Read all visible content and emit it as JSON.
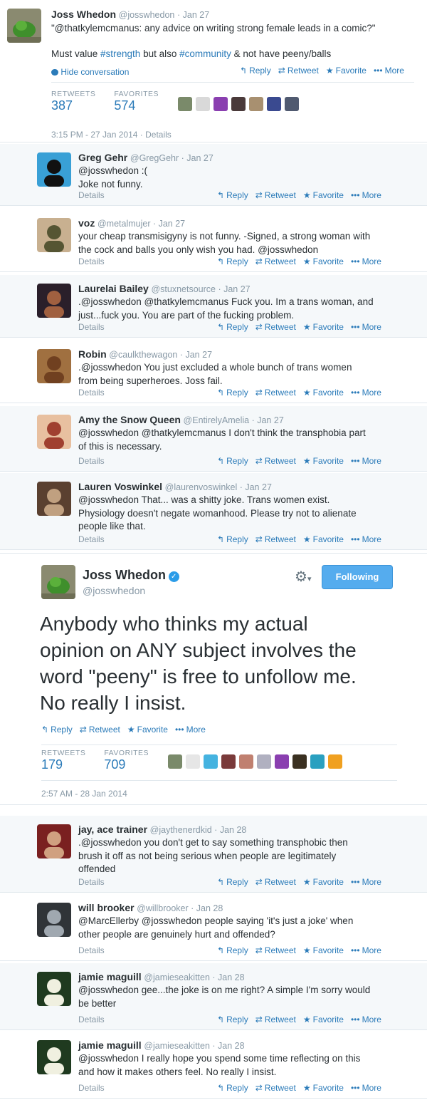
{
  "first_tweet": {
    "name": "Joss Whedon",
    "handle": "@josswhedon",
    "date": "Jan 27",
    "quote": "\"@thatkylemcmanus: any advice on writing strong female leads in a comic?\"",
    "text_prefix": "Must value ",
    "tag1": "#strength",
    "text_mid": " but also ",
    "tag2": "#community",
    "text_suffix": " & not have peeny/balls",
    "hide_conversation": "Hide conversation",
    "actions": {
      "reply": "Reply",
      "retweet": "Retweet",
      "favorite": "Favorite",
      "more": "More"
    },
    "retweets_label": "RETWEETS",
    "retweets": "387",
    "favorites_label": "FAVORITES",
    "favorites": "574",
    "timestamp": "3:15 PM - 27 Jan 2014",
    "details": "Details"
  },
  "replies_a": [
    {
      "name": "Greg Gehr",
      "handle": "@GregGehr",
      "date": "Jan 27",
      "lines": [
        "@josswhedon :(",
        "Joke not funny."
      ],
      "details": "Details"
    },
    {
      "name": "voz",
      "handle": "@metalmujer",
      "date": "Jan 27",
      "lines": [
        "your cheap transmisigyny is not funny. -Signed, a strong woman with",
        "the cock and balls you only wish you had. @josswhedon"
      ],
      "details": "Details"
    },
    {
      "name": "Laurelai Bailey",
      "handle": "@stuxnetsource",
      "date": "Jan 27",
      "lines": [
        ".@josswhedon @thatkylemcmanus Fuck you. Im a trans woman, and",
        "just...fuck you. You are part of the fucking problem."
      ],
      "details": "Details"
    },
    {
      "name": "Robin",
      "handle": "@caulkthewagon",
      "date": "Jan 27",
      "lines": [
        ".@josswhedon You just excluded a whole bunch of trans women",
        "from being superheroes. Joss fail."
      ],
      "details": "Details"
    },
    {
      "name": "Amy the Snow Queen",
      "handle": "@EntirelyAmelia",
      "date": "Jan 27",
      "lines": [
        "@josswhedon @thatkylemcmanus I don't think the transphobia part",
        "of this is necessary."
      ],
      "details": "Details"
    },
    {
      "name": "Lauren Voswinkel",
      "handle": "@laurenvoswinkel",
      "date": "Jan 27",
      "lines": [
        "@josswhedon That... was a shitty joke. Trans women exist.",
        "Physiology doesn't negate womanhood. Please try not to alienate",
        "people like that."
      ],
      "details": "Details"
    }
  ],
  "main_tweet": {
    "name": "Joss Whedon",
    "handle": "@josswhedon",
    "follow_label": "Following",
    "lines": [
      "Anybody who thinks my actual",
      "opinion on ANY subject involves the",
      "word \"peeny\" is free to unfollow me.",
      "No really I insist."
    ],
    "actions": {
      "reply": "Reply",
      "retweet": "Retweet",
      "favorite": "Favorite",
      "more": "More"
    },
    "retweets_label": "RETWEETS",
    "retweets": "179",
    "favorites_label": "FAVORITES",
    "favorites": "709",
    "timestamp": "2:57 AM - 28 Jan 2014"
  },
  "replies_b": [
    {
      "name": "jay, ace trainer",
      "handle": "@jaythenerdkid",
      "date": "Jan 28",
      "lines": [
        ".@josswhedon you don't get to say something transphobic then",
        "brush it off as not being serious when people are legitimately",
        "offended"
      ],
      "details": "Details"
    },
    {
      "name": "will brooker",
      "handle": "@willbrooker",
      "date": "Jan 28",
      "lines": [
        "@MarcEllerby @josswhedon people saying 'it's just a joke' when",
        "other people are genuinely hurt and offended?"
      ],
      "details": "Details"
    },
    {
      "name": "jamie maguill",
      "handle": "@jamieseakitten",
      "date": "Jan 28",
      "lines": [
        "@josswhedon gee...the joke is on me right? A simple I'm sorry would",
        "be better"
      ],
      "details": "Details"
    },
    {
      "name": "jamie maguill",
      "handle": "@jamieseakitten",
      "date": "Jan 28",
      "lines": [
        "@josswhedon I really hope you spend some time reflecting on this",
        "and how it makes others feel. No really I insist."
      ],
      "details": "Details"
    }
  ],
  "action_labels": {
    "reply": "Reply",
    "retweet": "Retweet",
    "favorite": "Favorite",
    "more": "More"
  },
  "colors": {
    "link": "#2b7bb9",
    "follow_button": "#55acee",
    "muted": "#8899a6"
  },
  "icons": [
    "reply-icon",
    "retweet-icon",
    "star-icon",
    "more-icon",
    "gear-icon",
    "verified-icon",
    "speech-bubble-icon"
  ]
}
